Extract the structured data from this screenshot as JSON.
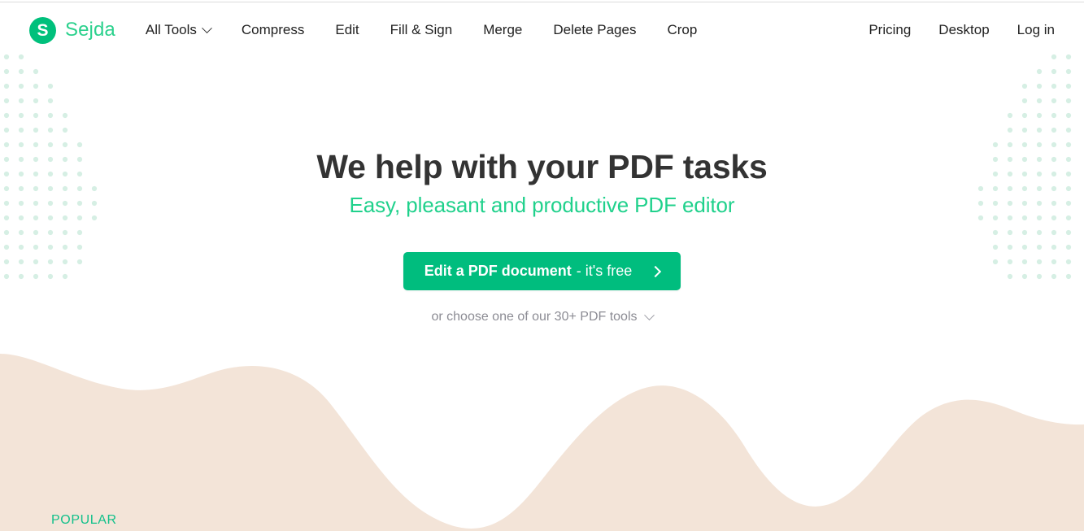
{
  "brand": {
    "mark_letter": "S",
    "name": "Sejda",
    "mark_color": "#00c07c",
    "name_color": "#2bd18d"
  },
  "nav": {
    "left_items": [
      {
        "label": "All Tools",
        "has_caret": true
      },
      {
        "label": "Compress",
        "has_caret": false
      },
      {
        "label": "Edit",
        "has_caret": false
      },
      {
        "label": "Fill & Sign",
        "has_caret": false
      },
      {
        "label": "Merge",
        "has_caret": false
      },
      {
        "label": "Delete Pages",
        "has_caret": false
      },
      {
        "label": "Crop",
        "has_caret": false
      }
    ],
    "right_items": [
      {
        "label": "Pricing"
      },
      {
        "label": "Desktop"
      },
      {
        "label": "Log in"
      }
    ]
  },
  "hero": {
    "title": "We help with your PDF tasks",
    "subtitle": "Easy, pleasant and productive PDF editor",
    "cta_strong": "Edit a PDF document",
    "cta_light": "- it's free",
    "cta_color": "#00bd7e",
    "tools_link": "or choose one of our 30+ PDF tools"
  },
  "section": {
    "popular_label": "POPULAR",
    "popular_color": "#12c08a"
  },
  "decor": {
    "dot_color": "#d6efe4",
    "wave_color": "#f3e4d8"
  }
}
